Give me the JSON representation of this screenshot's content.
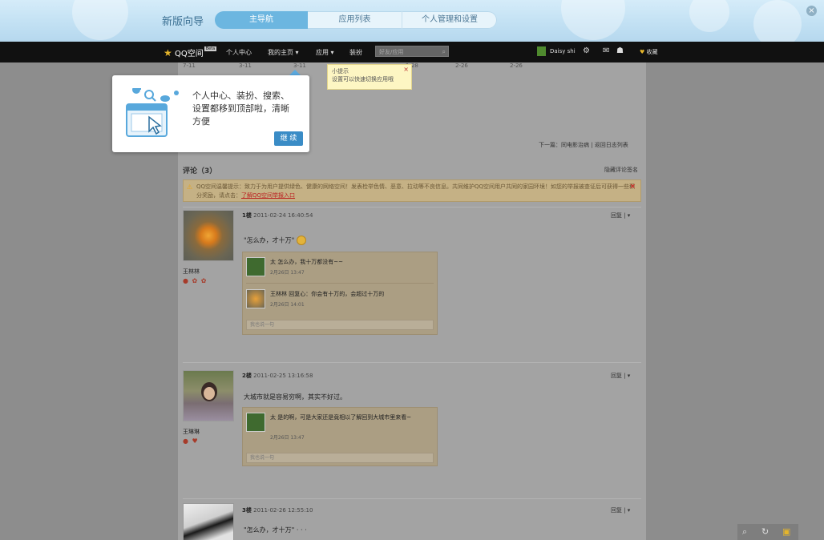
{
  "guide": {
    "title": "新版向导",
    "tabs": [
      {
        "label": "主导航",
        "active": true
      },
      {
        "label": "应用列表",
        "active": false
      },
      {
        "label": "个人管理和设置",
        "active": false
      }
    ],
    "close_icon": "close-icon"
  },
  "nav": {
    "logo_text": "QQ空间",
    "logo_badge": "Beta",
    "items": [
      "个人中心",
      "我的主页",
      "应用",
      "装扮"
    ],
    "search_placeholder": "好友/应用",
    "user_name": "Daisy shi",
    "settings_icon": "gear-icon",
    "collect_label": "收藏"
  },
  "prev_dates": [
    "7-11",
    "3-11",
    "3-11",
    "1-28",
    "2-26",
    "2-26"
  ],
  "tooltip_main": {
    "text": "个人中心、装扮、搜索、设置都移到顶部啦，清晰方便",
    "button": "继 续"
  },
  "tooltip_small": {
    "title": "小提示",
    "text": "设置可以快速切换应用哦"
  },
  "next_link": "下一篇：同电影治病  |  返回日志列表",
  "comments": {
    "title": "评论（3）",
    "hide_sign": "隐藏评论签名",
    "notice_text": "QQ空间温馨提示：致力于为用户提供绿色、健康的网络空间！发表检举色情、恶意、拉动等不良信息。共同维护QQ空间用户共同的家园环境！如您的举报被查证后可获得一些积分奖励，请点击：",
    "notice_link": "了解QQ空间举报入口",
    "items": [
      {
        "floor": "1楼",
        "time": "2011-02-24 16:40:54",
        "user": "王林林",
        "text": "\"怎么办，才十万\"",
        "replies": [
          {
            "text": "太  怎么办，我十万都没有~~",
            "time": "2月26日 13:47"
          },
          {
            "text": "王林林 回复心：你会有十万的，会超过十万的",
            "time": "2月26日 14:01"
          }
        ],
        "input_placeholder": "我也说一句"
      },
      {
        "floor": "2楼",
        "time": "2011-02-25 13:16:58",
        "user": "王琳琳",
        "text": "大城市就是容易穷啊，其实不好过。",
        "replies": [
          {
            "text": "太  是的啊，可是大家还是竟相以了解回到大城市里来看~",
            "time": "2月26日 13:47"
          }
        ],
        "input_placeholder": "我也说一句"
      },
      {
        "floor": "3楼",
        "time": "2011-02-26 12:55:10",
        "user": "",
        "text": "\"怎么办，才十万\" · · ·",
        "replies": [],
        "input_placeholder": ""
      }
    ],
    "reply_label": "回复  |  ▾"
  }
}
